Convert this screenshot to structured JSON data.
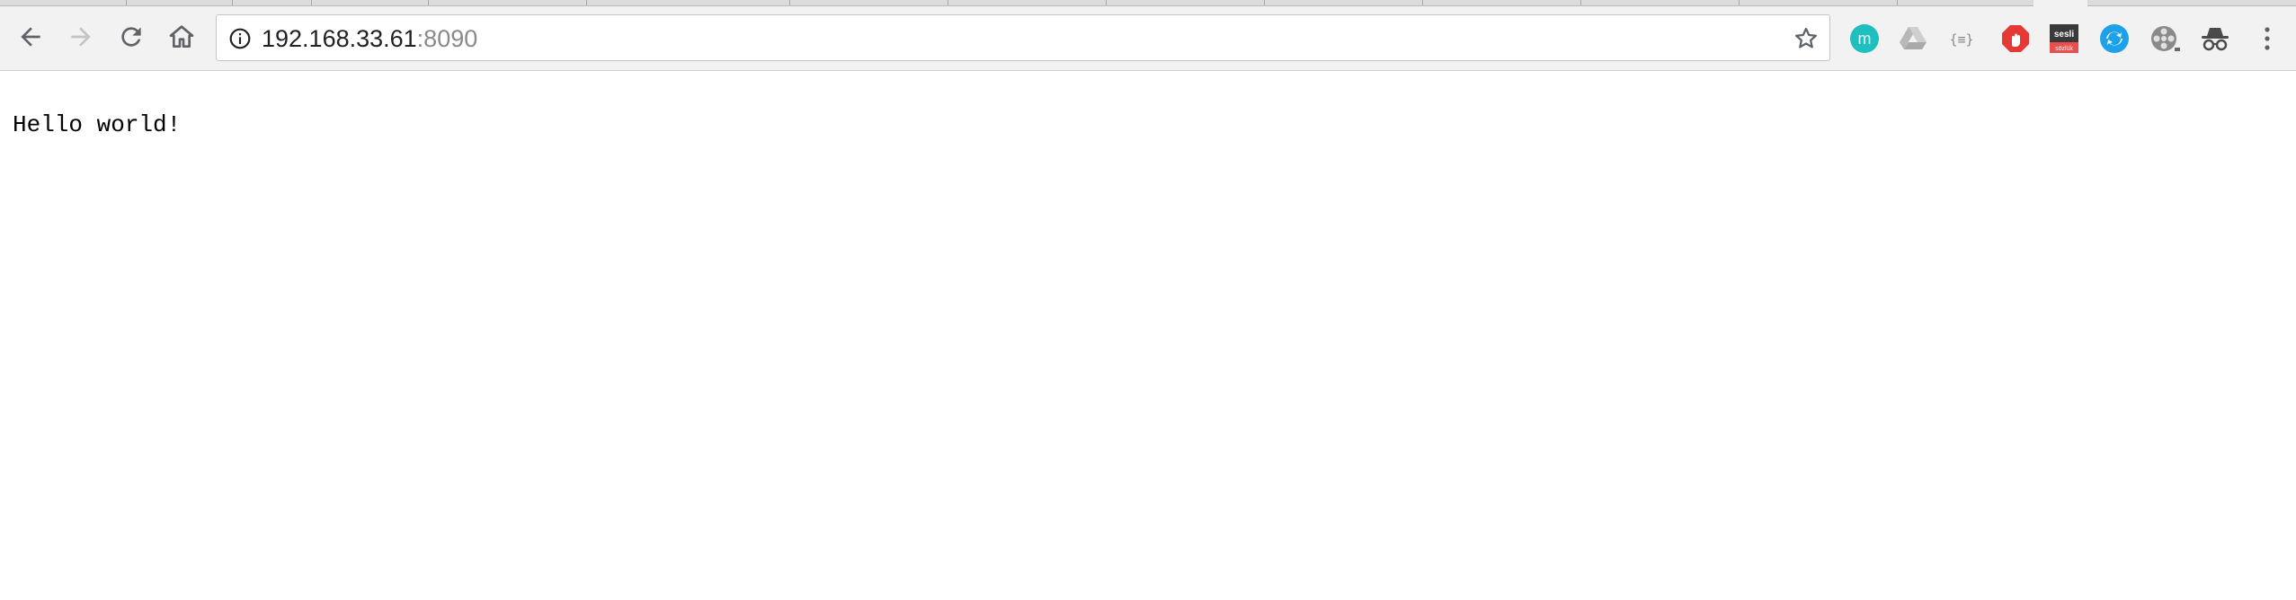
{
  "browser": {
    "address_bar": {
      "host": "192.168.33.61",
      "port": ":8090"
    },
    "toolbar_icons": [
      "back-arrow-icon",
      "forward-arrow-icon",
      "reload-icon",
      "home-icon",
      "info-icon",
      "star-icon"
    ],
    "extensions": [
      {
        "name": "m-extension-icon",
        "letter": "m",
        "color": "#1fbfbf"
      },
      {
        "name": "drive-icon"
      },
      {
        "name": "json-formatter-icon",
        "label": "{≡}"
      },
      {
        "name": "adblock-icon",
        "color": "#e53935"
      },
      {
        "name": "sesli-sozluk-icon",
        "label_top": "sesli",
        "label_bottom": "sözlük"
      },
      {
        "name": "sync-icon",
        "color": "#1da1e8"
      },
      {
        "name": "film-reel-icon"
      },
      {
        "name": "incognito-icon"
      },
      {
        "name": "menu-kebab-icon"
      }
    ]
  },
  "page": {
    "text": "Hello world!"
  }
}
